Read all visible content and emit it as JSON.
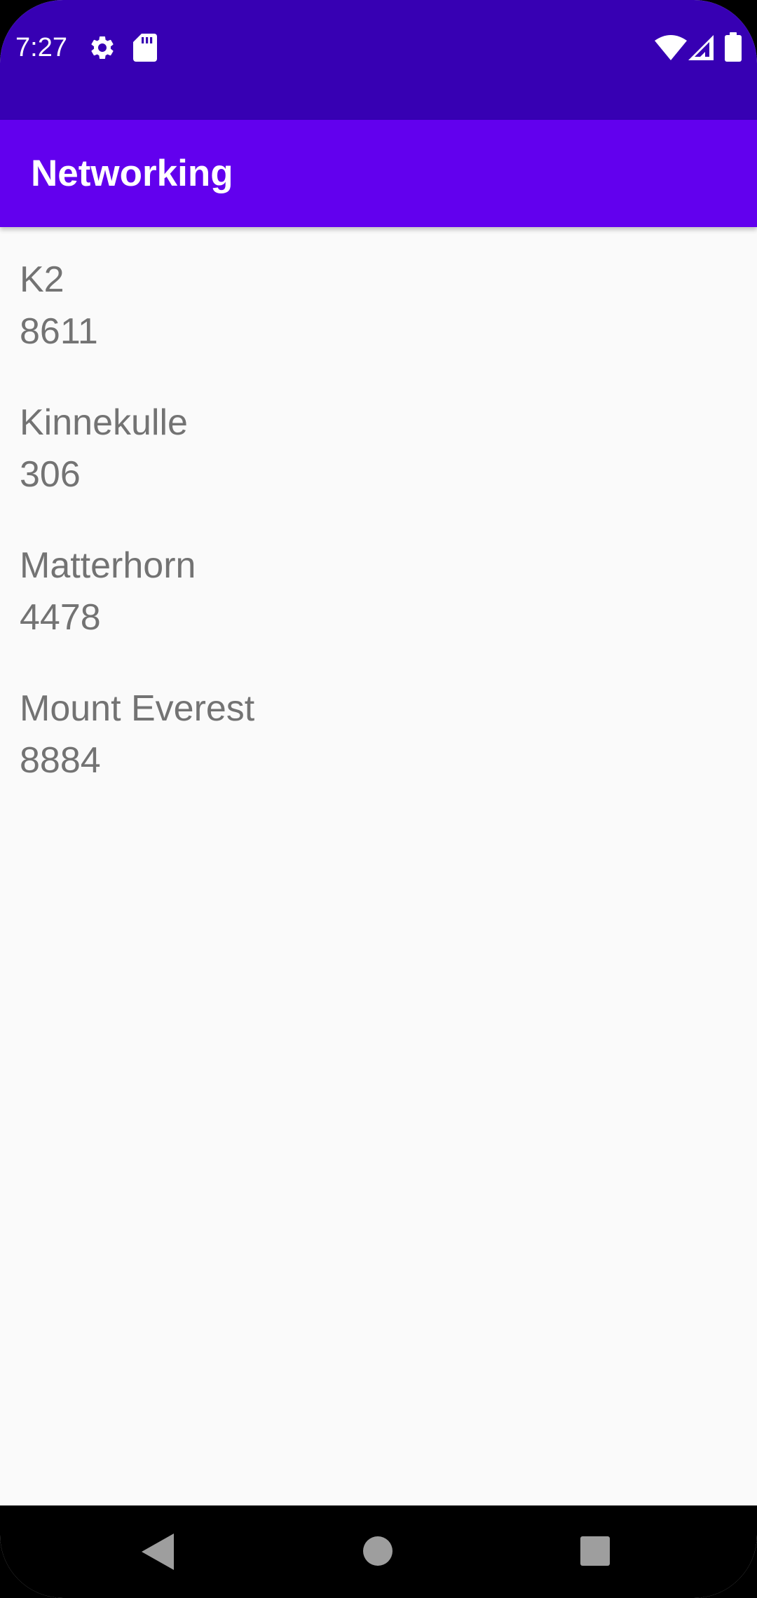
{
  "status_bar": {
    "time": "7:27",
    "icons": [
      "gear-icon",
      "sd-card-icon",
      "wifi-icon",
      "signal-icon",
      "battery-icon"
    ],
    "background": "#3700b3"
  },
  "app_bar": {
    "title": "Networking",
    "background": "#6200ee"
  },
  "mountains": [
    {
      "name": "K2",
      "height": "8611"
    },
    {
      "name": "Kinnekulle",
      "height": "306"
    },
    {
      "name": "Matterhorn",
      "height": "4478"
    },
    {
      "name": "Mount Everest",
      "height": "8884"
    }
  ],
  "nav_bar": {
    "buttons": [
      "back-icon",
      "home-icon",
      "recents-icon"
    ]
  },
  "colors": {
    "primary": "#6200ee",
    "primary_dark": "#3700b3",
    "text_secondary": "#737373",
    "background": "#fafafa"
  }
}
